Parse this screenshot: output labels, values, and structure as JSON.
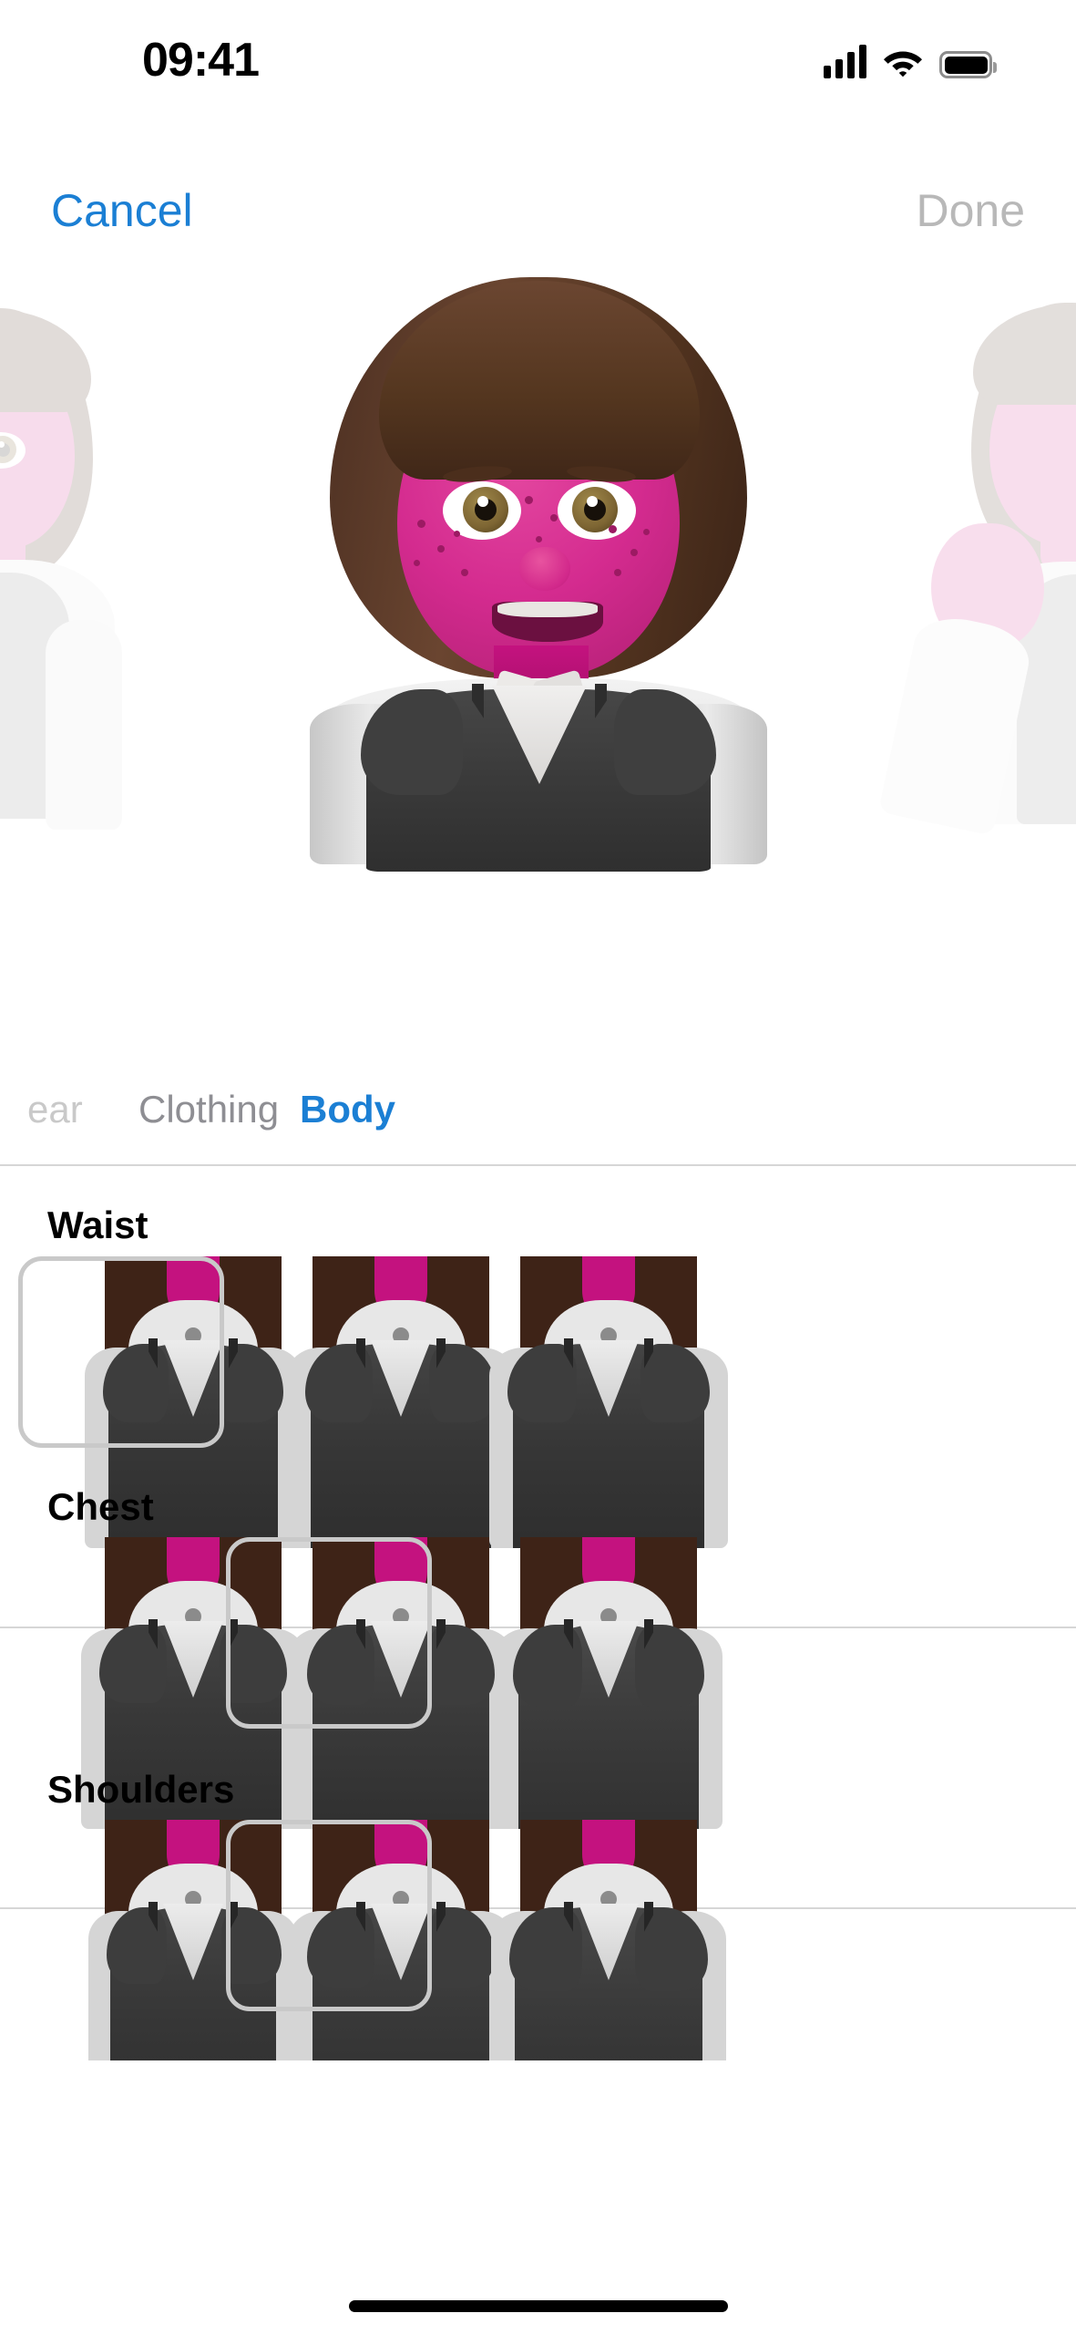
{
  "status_bar": {
    "time": "09:41",
    "cellular_icon": "cellular-bars-icon",
    "wifi_icon": "wifi-icon",
    "battery_icon": "battery-full-icon"
  },
  "nav_bar": {
    "cancel_label": "Cancel",
    "done_label": "Done",
    "cancel_color": "#1b7fd4",
    "done_color": "#b8b8b8",
    "done_enabled": false
  },
  "preview": {
    "carousel_position": "center",
    "avatars": [
      {
        "name": "previous-memoji",
        "state": "faded-peek",
        "side": "left"
      },
      {
        "name": "current-memoji",
        "state": "active",
        "side": "center"
      },
      {
        "name": "next-memoji",
        "state": "faded-peek",
        "side": "right"
      }
    ],
    "skin_color": "#d42b8f",
    "hair_color": "#4b2d1d",
    "vest_color": "#3b3b3b",
    "shirt_color": "#e7e7e7"
  },
  "tabs": {
    "items": [
      {
        "label": "ear",
        "state": "partial"
      },
      {
        "label": "Clothing",
        "state": "inactive"
      },
      {
        "label": "Body",
        "state": "active"
      }
    ],
    "active_color": "#1b7fd4",
    "inactive_color": "#8e8e93"
  },
  "sections": [
    {
      "title": "Waist",
      "name": "waist",
      "selected_index": 0,
      "options": [
        {
          "label": "Waist option 1",
          "variant": "slim"
        },
        {
          "label": "Waist option 2",
          "variant": "regular"
        },
        {
          "label": "Waist option 3",
          "variant": "wide"
        }
      ]
    },
    {
      "title": "Chest",
      "name": "chest",
      "selected_index": 1,
      "options": [
        {
          "label": "Chest option 1",
          "variant": "small"
        },
        {
          "label": "Chest option 2",
          "variant": "medium"
        },
        {
          "label": "Chest option 3",
          "variant": "large"
        }
      ]
    },
    {
      "title": "Shoulders",
      "name": "shoulders",
      "selected_index": 1,
      "options": [
        {
          "label": "Shoulders option 1",
          "variant": "narrow"
        },
        {
          "label": "Shoulders option 2",
          "variant": "regular"
        },
        {
          "label": "Shoulders option 3",
          "variant": "broad"
        }
      ]
    }
  ],
  "selection_border_color": "#c9c9c9",
  "home_indicator": {
    "name": "home-indicator",
    "color": "#000000"
  }
}
